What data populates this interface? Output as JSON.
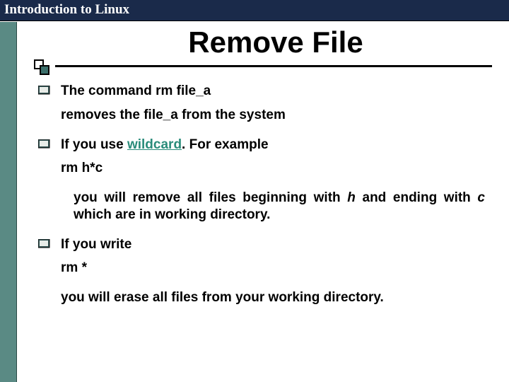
{
  "header": {
    "title": "Introduction to Linux"
  },
  "slide": {
    "title": "Remove File"
  },
  "bullets": {
    "b1": {
      "line1": "The command rm file_a",
      "line2": "removes the file_a from the system"
    },
    "b2": {
      "prefix": "If you use ",
      "link": "wildcard",
      "suffix": ". For example",
      "line2": "rm h*c",
      "detail_pre": "you will remove all files beginning with ",
      "detail_h": "h",
      "detail_mid": " and ending with ",
      "detail_c": "c",
      "detail_post": " which are in working directory."
    },
    "b3": {
      "line1": "If you write",
      "line2": "rm *",
      "line3": "you will erase all files from your working directory."
    }
  }
}
